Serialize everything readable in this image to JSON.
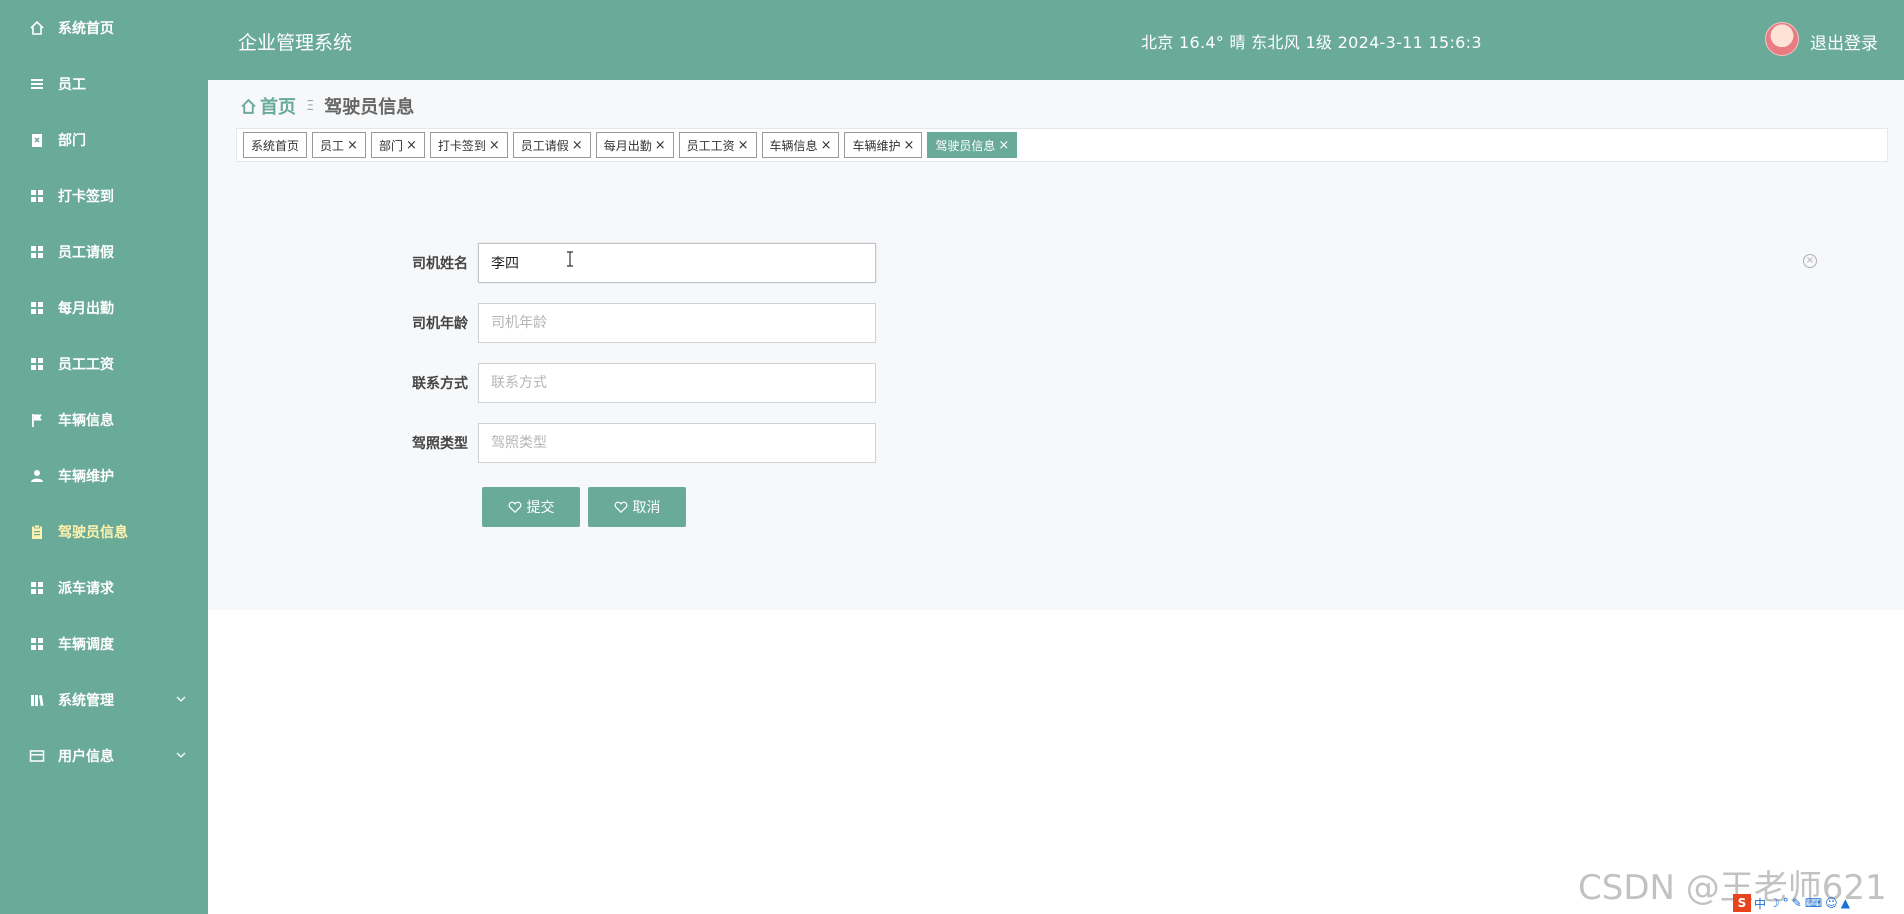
{
  "sidebar": {
    "items": [
      {
        "label": "系统首页",
        "icon": "home-icon"
      },
      {
        "label": "员工",
        "icon": "list-icon"
      },
      {
        "label": "部门",
        "icon": "clipboard-icon"
      },
      {
        "label": "打卡签到",
        "icon": "grid-icon"
      },
      {
        "label": "员工请假",
        "icon": "grid-icon"
      },
      {
        "label": "每月出勤",
        "icon": "grid-icon"
      },
      {
        "label": "员工工资",
        "icon": "grid-icon"
      },
      {
        "label": "车辆信息",
        "icon": "flag-icon"
      },
      {
        "label": "车辆维护",
        "icon": "user-icon"
      },
      {
        "label": "驾驶员信息",
        "icon": "clipboard-icon",
        "active": true
      },
      {
        "label": "派车请求",
        "icon": "grid-icon"
      },
      {
        "label": "车辆调度",
        "icon": "grid-icon"
      },
      {
        "label": "系统管理",
        "icon": "book-icon",
        "expandable": true
      },
      {
        "label": "用户信息",
        "icon": "card-icon",
        "expandable": true
      }
    ]
  },
  "header": {
    "title": "企业管理系统",
    "weather": "北京  16.4°  晴  东北风  1级    2024-3-11 15:6:3",
    "logout": "退出登录"
  },
  "breadcrumb": {
    "home": "首页",
    "separator": "Ξ",
    "current": "驾驶员信息"
  },
  "tags": [
    {
      "label": "系统首页",
      "closable": false
    },
    {
      "label": "员工",
      "closable": true
    },
    {
      "label": "部门",
      "closable": true
    },
    {
      "label": "打卡签到",
      "closable": true
    },
    {
      "label": "员工请假",
      "closable": true
    },
    {
      "label": "每月出勤",
      "closable": true
    },
    {
      "label": "员工工资",
      "closable": true
    },
    {
      "label": "车辆信息",
      "closable": true
    },
    {
      "label": "车辆维护",
      "closable": true
    },
    {
      "label": "驾驶员信息",
      "closable": true,
      "active": true
    }
  ],
  "form": {
    "name": {
      "label": "司机姓名",
      "value": "李四",
      "placeholder": "司机姓名"
    },
    "age": {
      "label": "司机年龄",
      "value": "",
      "placeholder": "司机年龄"
    },
    "contact": {
      "label": "联系方式",
      "value": "",
      "placeholder": "联系方式"
    },
    "license": {
      "label": "驾照类型",
      "value": "",
      "placeholder": "驾照类型"
    },
    "submit": "提交",
    "cancel": "取消"
  },
  "overlay": {
    "watermark": "CSDN @王老师621",
    "ime_s": "S",
    "ime_zh": "中"
  },
  "colors": {
    "accent": "#6aaa98",
    "active_nav_text": "#fff3b0"
  }
}
